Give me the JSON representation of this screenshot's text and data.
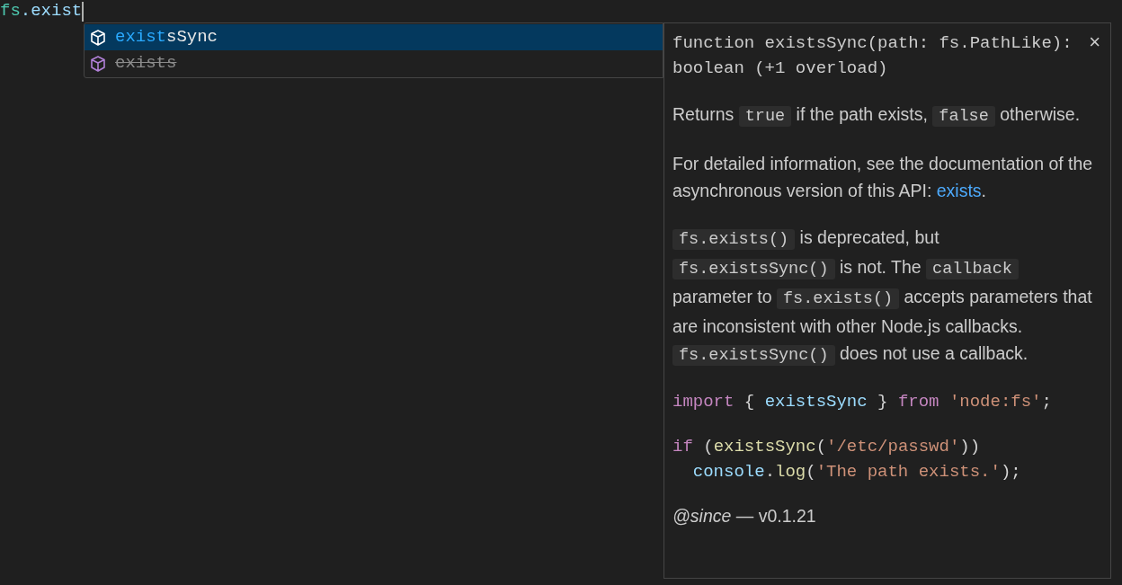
{
  "editor": {
    "line": [
      {
        "kind": "variable",
        "text": "fs"
      },
      {
        "kind": "plain",
        "text": ".exist"
      }
    ]
  },
  "suggestions": [
    {
      "match": "exist",
      "rest": "sSync",
      "selected": true,
      "deprecated": false
    },
    {
      "rest": "exists",
      "selected": false,
      "deprecated": true
    }
  ],
  "details": {
    "signature": "function existsSync(path: fs.PathLike): boolean (+1 overload)",
    "close": "×",
    "blocks": [
      {
        "kind": "text",
        "segments": [
          {
            "kind": "text",
            "text": "Returns "
          },
          {
            "kind": "code",
            "text": "true"
          },
          {
            "kind": "text",
            "text": " if the path exists, "
          },
          {
            "kind": "code",
            "text": "false"
          },
          {
            "kind": "text",
            "text": " otherwise."
          }
        ]
      },
      {
        "kind": "text",
        "segments": [
          {
            "kind": "text",
            "text": "For detailed information, see the documentation of the asynchronous version of this API: "
          },
          {
            "kind": "link",
            "text": "exists"
          },
          {
            "kind": "text",
            "text": "."
          }
        ]
      },
      {
        "kind": "text",
        "segments": [
          {
            "kind": "code",
            "text": "fs.exists()"
          },
          {
            "kind": "text",
            "text": " is deprecated, but "
          },
          {
            "kind": "code",
            "text": "fs.existsSync()"
          },
          {
            "kind": "text",
            "text": " is not. The "
          },
          {
            "kind": "code",
            "text": "callback"
          },
          {
            "kind": "text",
            "text": " parameter to "
          },
          {
            "kind": "code",
            "text": "fs.exists()"
          },
          {
            "kind": "text",
            "text": " accepts parameters that are inconsistent with other Node.js callbacks. "
          },
          {
            "kind": "code",
            "text": "fs.existsSync()"
          },
          {
            "kind": "text",
            "text": " does not use a callback."
          }
        ]
      },
      {
        "kind": "code",
        "lines": [
          [
            {
              "kind": "keyword",
              "text": "import"
            },
            {
              "kind": "punct",
              "text": " { "
            },
            {
              "kind": "variable",
              "text": "existsSync"
            },
            {
              "kind": "punct",
              "text": " } "
            },
            {
              "kind": "keyword",
              "text": "from"
            },
            {
              "kind": "string",
              "text": " 'node:fs'"
            },
            {
              "kind": "punct",
              "text": ";"
            }
          ]
        ]
      },
      {
        "kind": "code",
        "lines": [
          [
            {
              "kind": "keyword",
              "text": "if"
            },
            {
              "kind": "punct",
              "text": " ("
            },
            {
              "kind": "function",
              "text": "existsSync"
            },
            {
              "kind": "punct",
              "text": "("
            },
            {
              "kind": "string",
              "text": "'/etc/passwd'"
            },
            {
              "kind": "punct",
              "text": "))"
            }
          ],
          [
            {
              "kind": "variable",
              "text": "  console"
            },
            {
              "kind": "punct",
              "text": "."
            },
            {
              "kind": "function",
              "text": "log"
            },
            {
              "kind": "punct",
              "text": "("
            },
            {
              "kind": "string",
              "text": "'The path exists.'"
            },
            {
              "kind": "punct",
              "text": ");"
            }
          ]
        ]
      },
      {
        "kind": "since",
        "text": "*@since* — v0.1.21"
      }
    ]
  }
}
